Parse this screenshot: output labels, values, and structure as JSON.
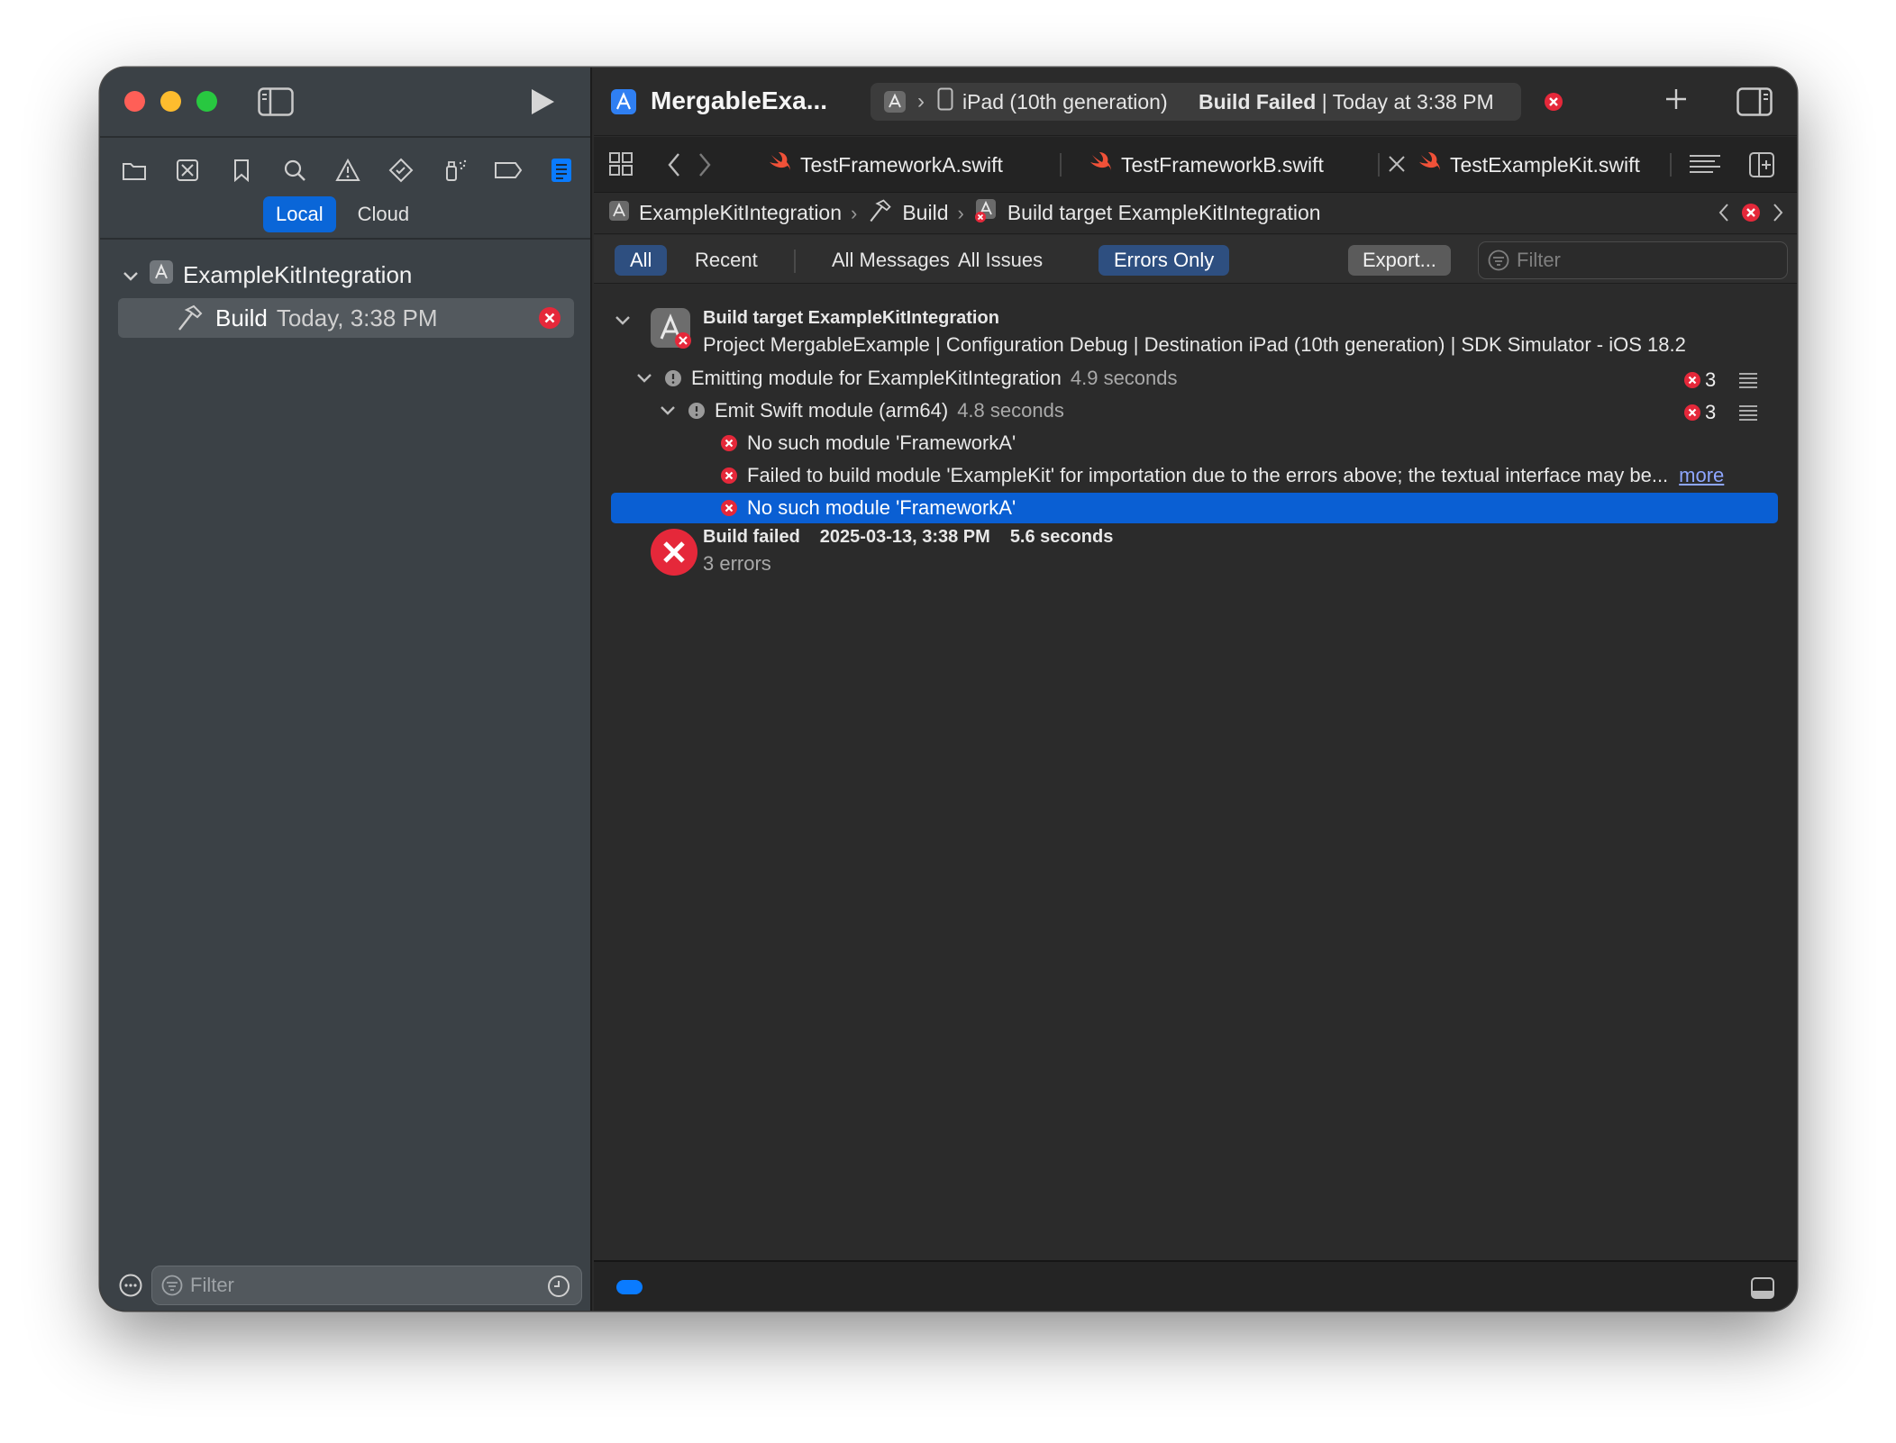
{
  "window": {
    "project_name": "MergableExa...",
    "scheme": {
      "device": "iPad (10th generation)",
      "status_bold": "Build Failed",
      "status_rest": " | Today at 3:38 PM"
    }
  },
  "sidebar": {
    "segment": {
      "local": "Local",
      "cloud": "Cloud"
    },
    "tree": {
      "root": "ExampleKitIntegration",
      "item_label": "Build",
      "item_time": "Today, 3:38 PM"
    },
    "filter_placeholder": "Filter"
  },
  "tabs": [
    {
      "label": "TestFrameworkA.swift"
    },
    {
      "label": "TestFrameworkB.swift"
    },
    {
      "label": "TestExampleKit.swift"
    }
  ],
  "pathbar": {
    "root": "ExampleKitIntegration",
    "build": "Build",
    "target": "Build target ExampleKitIntegration"
  },
  "filterbar": {
    "all": "All",
    "recent": "Recent",
    "all_messages": "All Messages",
    "all_issues": "All Issues",
    "errors_only": "Errors Only",
    "export": "Export...",
    "filter_placeholder": "Filter"
  },
  "log": {
    "target_title": "Build target ExampleKitIntegration",
    "target_detail": "Project MergableExample | Configuration Debug | Destination iPad (10th generation) | SDK Simulator - iOS 18.2",
    "emitting": {
      "label": "Emitting module for ExampleKitIntegration",
      "time": "4.9 seconds",
      "count": "3"
    },
    "emit_swift": {
      "label": "Emit Swift module (arm64)",
      "time": "4.8 seconds",
      "count": "3"
    },
    "errors": [
      "No such module 'FrameworkA'",
      "Failed to build module 'ExampleKit' for importation due to the errors above; the textual interface may be...",
      "No such module 'FrameworkA'"
    ],
    "more_link": "more",
    "summary": {
      "title": "Build failed",
      "date": "2025-03-13, 3:38 PM",
      "duration": "5.6 seconds",
      "errors": "3 errors"
    }
  },
  "colors": {
    "accent": "#0a66d8",
    "error": "#e5283a",
    "sidebar_bg": "#3b4146",
    "main_bg": "#2b2b2b"
  }
}
